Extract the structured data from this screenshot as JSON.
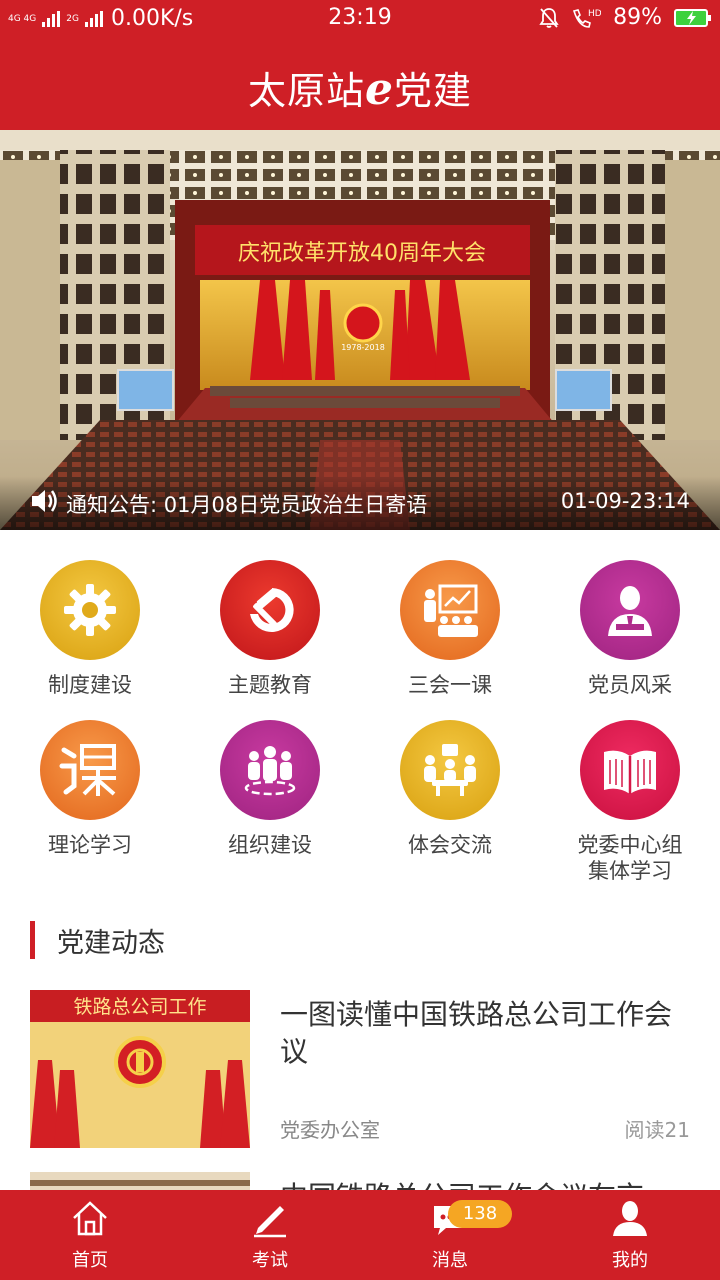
{
  "status_bar": {
    "network_1": "4G 4G",
    "network_2": "2G",
    "speed": "0.00K/s",
    "time": "23:19",
    "battery": "89%",
    "icons": [
      "mute-bell-icon",
      "hd-call-icon",
      "battery-charging-icon"
    ]
  },
  "header": {
    "title_prefix": "太原站",
    "title_mark": "e",
    "title_suffix": "党建"
  },
  "banner": {
    "image": "great-hall-assembly-photo",
    "hall_banner": "庆祝改革开放40周年大会",
    "emblem_years": "1978-2018",
    "notice_text": "通知公告: 01月08日党员政治生日寄语",
    "notice_time": "01-09-23:14"
  },
  "categories": [
    {
      "label": "制度建设",
      "icon": "gear-icon",
      "color": "#e8b318"
    },
    {
      "label": "主题教育",
      "icon": "party-emblem-icon",
      "color": "#d8201f"
    },
    {
      "label": "三会一课",
      "icon": "meeting-presentation-icon",
      "color": "#f07a2b"
    },
    {
      "label": "党员风采",
      "icon": "person-profile-icon",
      "color": "#b52d91"
    },
    {
      "label": "理论学习",
      "icon": "course-icon",
      "color": "#f07a2b"
    },
    {
      "label": "组织建设",
      "icon": "group-people-icon",
      "color": "#b52d91"
    },
    {
      "label": "体会交流",
      "icon": "discussion-icon",
      "color": "#e8b318"
    },
    {
      "label": "党委中心组\n集体学习",
      "label_line1": "党委中心组",
      "label_line2": "集体学习",
      "icon": "open-book-icon",
      "color": "#e2174e"
    }
  ],
  "section": {
    "title": "党建动态"
  },
  "news": [
    {
      "headline": "一图读懂中国铁路总公司工作会议",
      "source": "党委办公室",
      "reads": "阅读21",
      "thumb_text": "铁路总公司工作"
    },
    {
      "headline": "中国铁路总公司工作会议在京"
    }
  ],
  "tabbar": {
    "tabs": [
      {
        "label": "首页",
        "icon": "home-icon"
      },
      {
        "label": "考试",
        "icon": "pencil-icon"
      },
      {
        "label": "消息",
        "icon": "message-icon"
      },
      {
        "label": "我的",
        "icon": "user-icon"
      }
    ],
    "message_badge": "138"
  },
  "colors": {
    "brand_red": "#cf1f26",
    "badge": "#f5a623"
  }
}
